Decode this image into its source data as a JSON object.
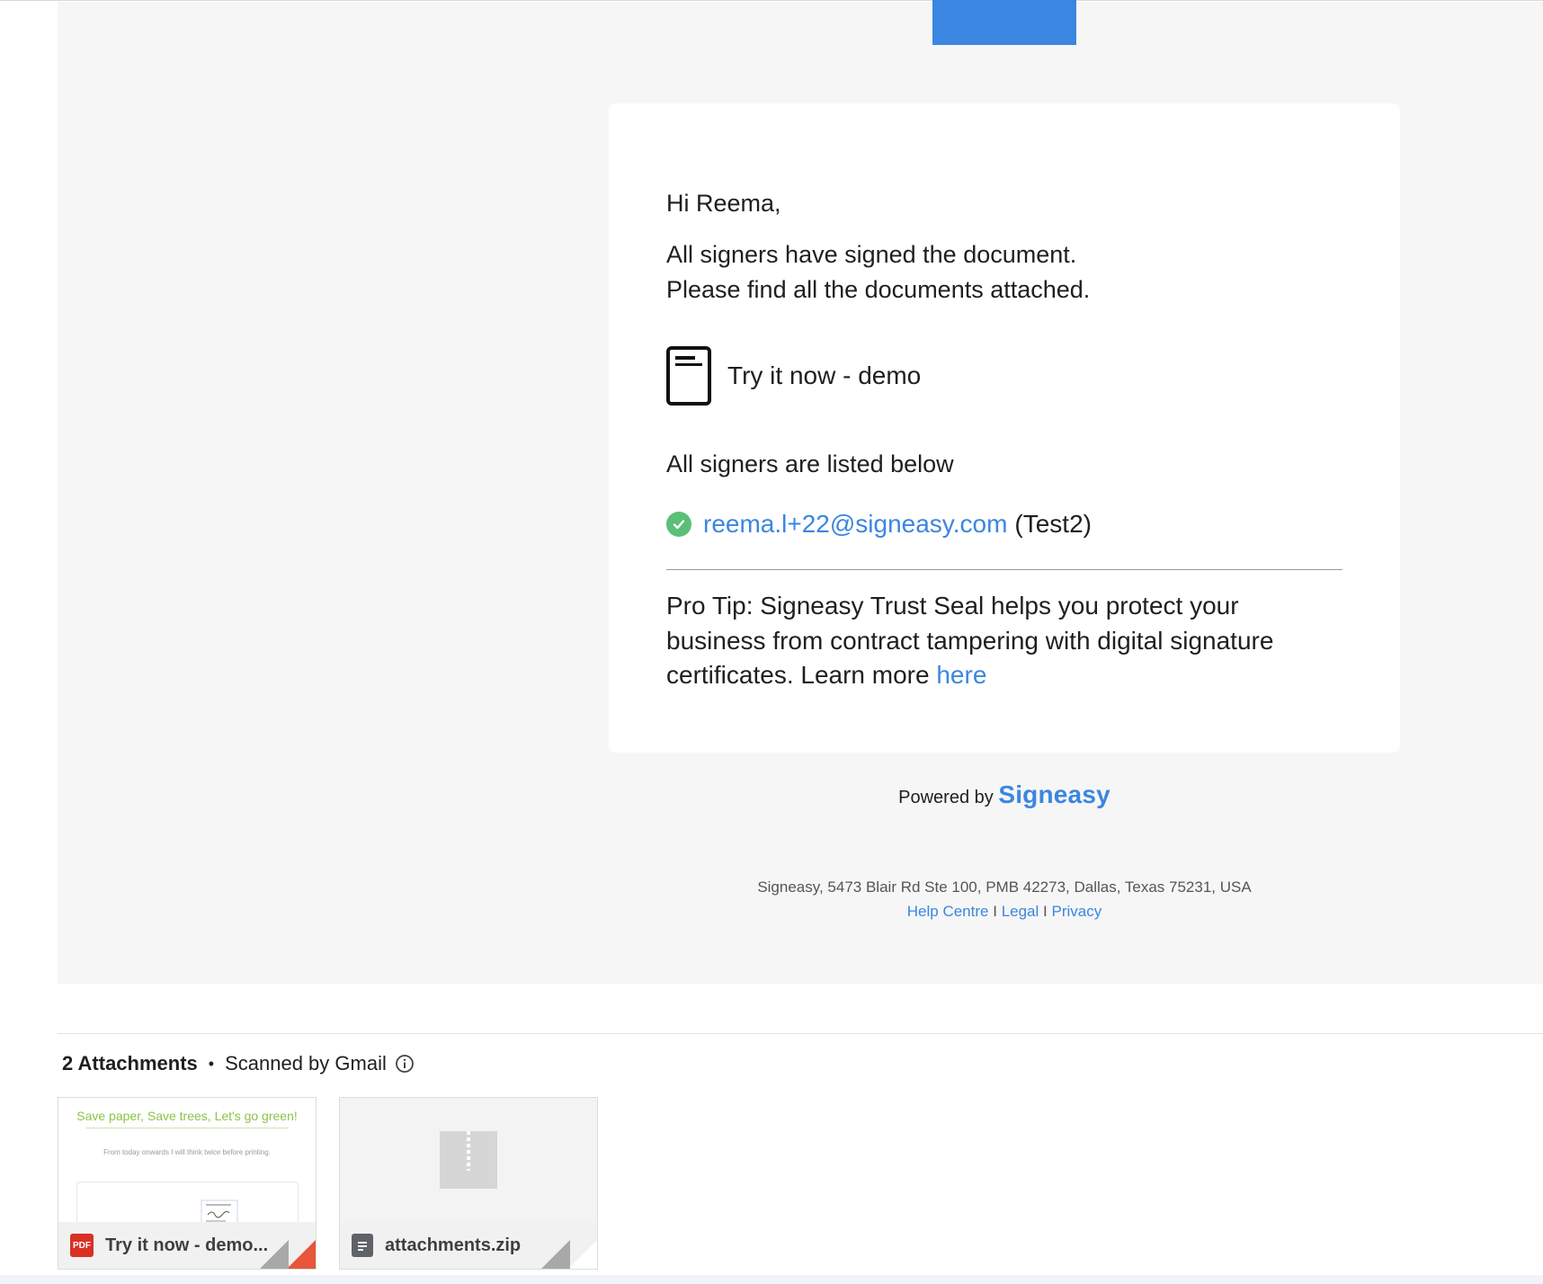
{
  "email": {
    "greeting": "Hi Reema,",
    "body_line1": "All signers have signed the document.",
    "body_line2": "Please find all the documents attached.",
    "document_name": "Try it now - demo",
    "signers_heading": "All signers are listed below",
    "signers": [
      {
        "email": "reema.l+22@signeasy.com",
        "name": "(Test2)",
        "status": "signed"
      }
    ],
    "pro_tip_text": "Pro Tip: Signeasy Trust Seal helps you protect your business from contract tampering with digital signature certificates. Learn more ",
    "pro_tip_link": "here",
    "powered_by_label": "Powered by",
    "brand": "Signeasy",
    "address": "Signeasy, 5473 Blair Rd Ste 100, PMB 42273, Dallas, Texas 75231, USA",
    "footer_links": {
      "help": "Help Centre",
      "legal": "Legal",
      "privacy": "Privacy",
      "separator": "I"
    }
  },
  "attachments": {
    "count_label": "2 Attachments",
    "bullet": "•",
    "scanned_label": "Scanned by Gmail",
    "items": [
      {
        "name": "Try it now - demo...",
        "type_label": "PDF",
        "preview_title": "Save paper, Save trees, Let's go green!",
        "preview_sub": "From today onwards I will think twice before printing."
      },
      {
        "name": "attachments.zip"
      }
    ]
  },
  "colors": {
    "brand_blue": "#3b86e0",
    "signed_green": "#5bbf78",
    "pdf_red": "#d93025",
    "background": "#f6f6f6"
  },
  "icons": {
    "document": "document-icon",
    "check": "check-circle-icon",
    "info": "info-icon",
    "pdf": "pdf-icon",
    "zip": "zip-file-icon"
  }
}
